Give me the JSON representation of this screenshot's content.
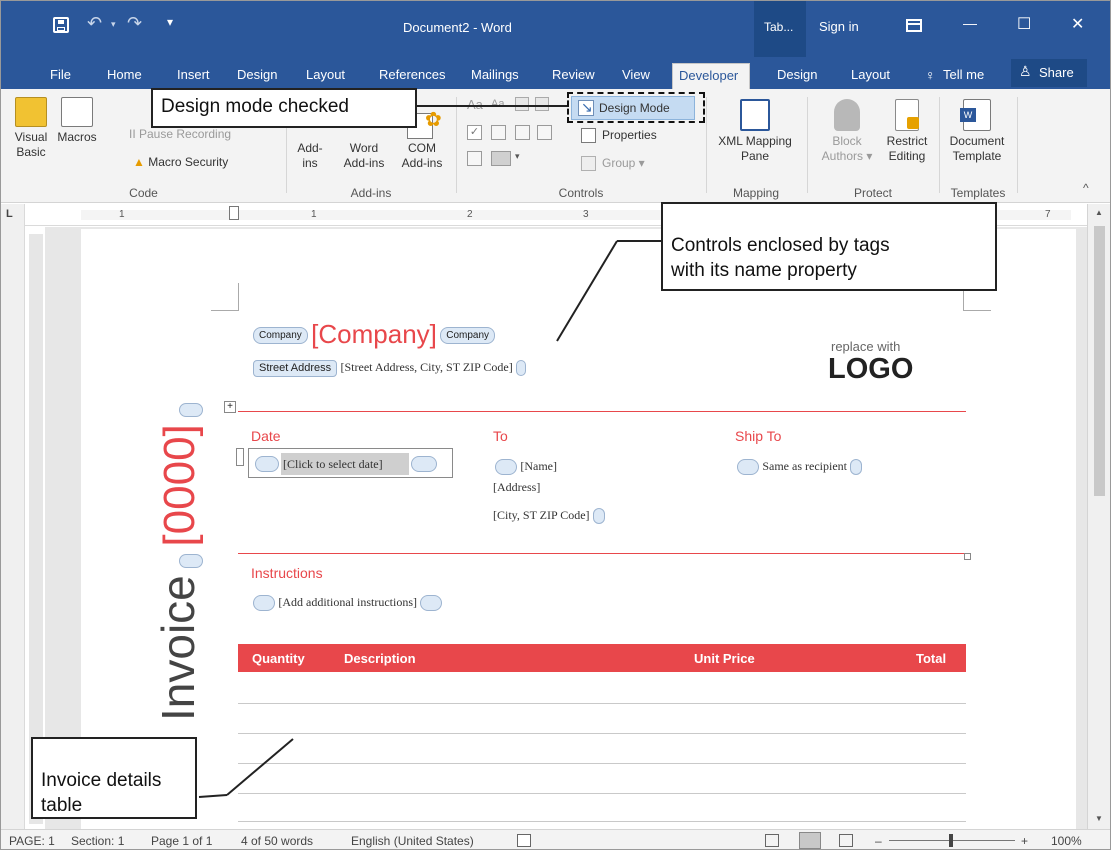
{
  "titlebar": {
    "title": "Document2  -  Word",
    "tab_tools": "Tab...",
    "sign_in": "Sign in",
    "minimize": "—",
    "maximize": "☐",
    "close": "✕",
    "undo": "↶",
    "redo": "↷",
    "save_icon": "save-icon",
    "qat_more": "⚬"
  },
  "tabs": [
    "File",
    "Home",
    "Insert",
    "Design",
    "Layout",
    "References",
    "Mailings",
    "Review",
    "View",
    "Developer",
    "Design",
    "Layout"
  ],
  "active_tab": "Developer",
  "tell_me": "Tell me",
  "share": "Share",
  "ribbon": {
    "code": {
      "label": "Code",
      "visual_basic": "Visual\nBasic",
      "macros": "Macros",
      "pause_recording": "II Pause Recording",
      "macro_security": "Macro Security"
    },
    "addins": {
      "label": "Add-ins",
      "addins": "Add-\nins",
      "word_addins": "Word\nAdd-ins",
      "com_addins": "COM\nAdd-ins"
    },
    "controls": {
      "label": "Controls",
      "design_mode": "Design Mode",
      "properties": "Properties",
      "group": "Group ▾",
      "aa1": "Aa",
      "aa2": "Aa"
    },
    "mapping": {
      "label": "Mapping",
      "xml_mapping": "XML Mapping\nPane"
    },
    "protect": {
      "label": "Protect",
      "block_authors": "Block\nAuthors ▾",
      "restrict_editing": "Restrict\nEditing"
    },
    "templates": {
      "label": "Templates",
      "document_template": "Document\nTemplate"
    }
  },
  "ruler": {
    "marks": [
      "1",
      "1",
      "2",
      "3",
      "7"
    ]
  },
  "document": {
    "company_tag_open": "Company",
    "company_text": "[Company]",
    "company_tag_close": "Company",
    "street_tag": "Street Address",
    "street_text": "[Street Address, City, ST ZIP Code]",
    "logo_small": "replace with",
    "logo_big": "LOGO",
    "invoice_title": "Invoice",
    "invoice_number": "[0000]",
    "date_label": "Date",
    "date_text": "[Click to select date]",
    "to_label": "To",
    "to_name": "[Name]",
    "to_address": "[Address]",
    "to_city": "[City, ST  ZIP Code]",
    "shipto_label": "Ship To",
    "shipto_text": "Same as recipient",
    "instructions_label": "Instructions",
    "instructions_text": "[Add additional instructions]",
    "table_headers": [
      "Quantity",
      "Description",
      "Unit Price",
      "Total"
    ]
  },
  "callouts": {
    "design_mode": "Design mode checked",
    "controls_tags": "Controls enclosed by tags\nwith its name property",
    "invoice_table": "Invoice details\ntable"
  },
  "status": {
    "page": "PAGE: 1",
    "section": "Section: 1",
    "page_of": "Page 1 of 1",
    "words": "4 of 50 words",
    "language": "English (United States)",
    "zoom": "100%",
    "zoom_minus": "–",
    "zoom_plus": "+"
  },
  "colors": {
    "word_blue": "#2b579a",
    "accent_red": "#e8474b",
    "ribbon_bg": "#f3f3f3"
  }
}
